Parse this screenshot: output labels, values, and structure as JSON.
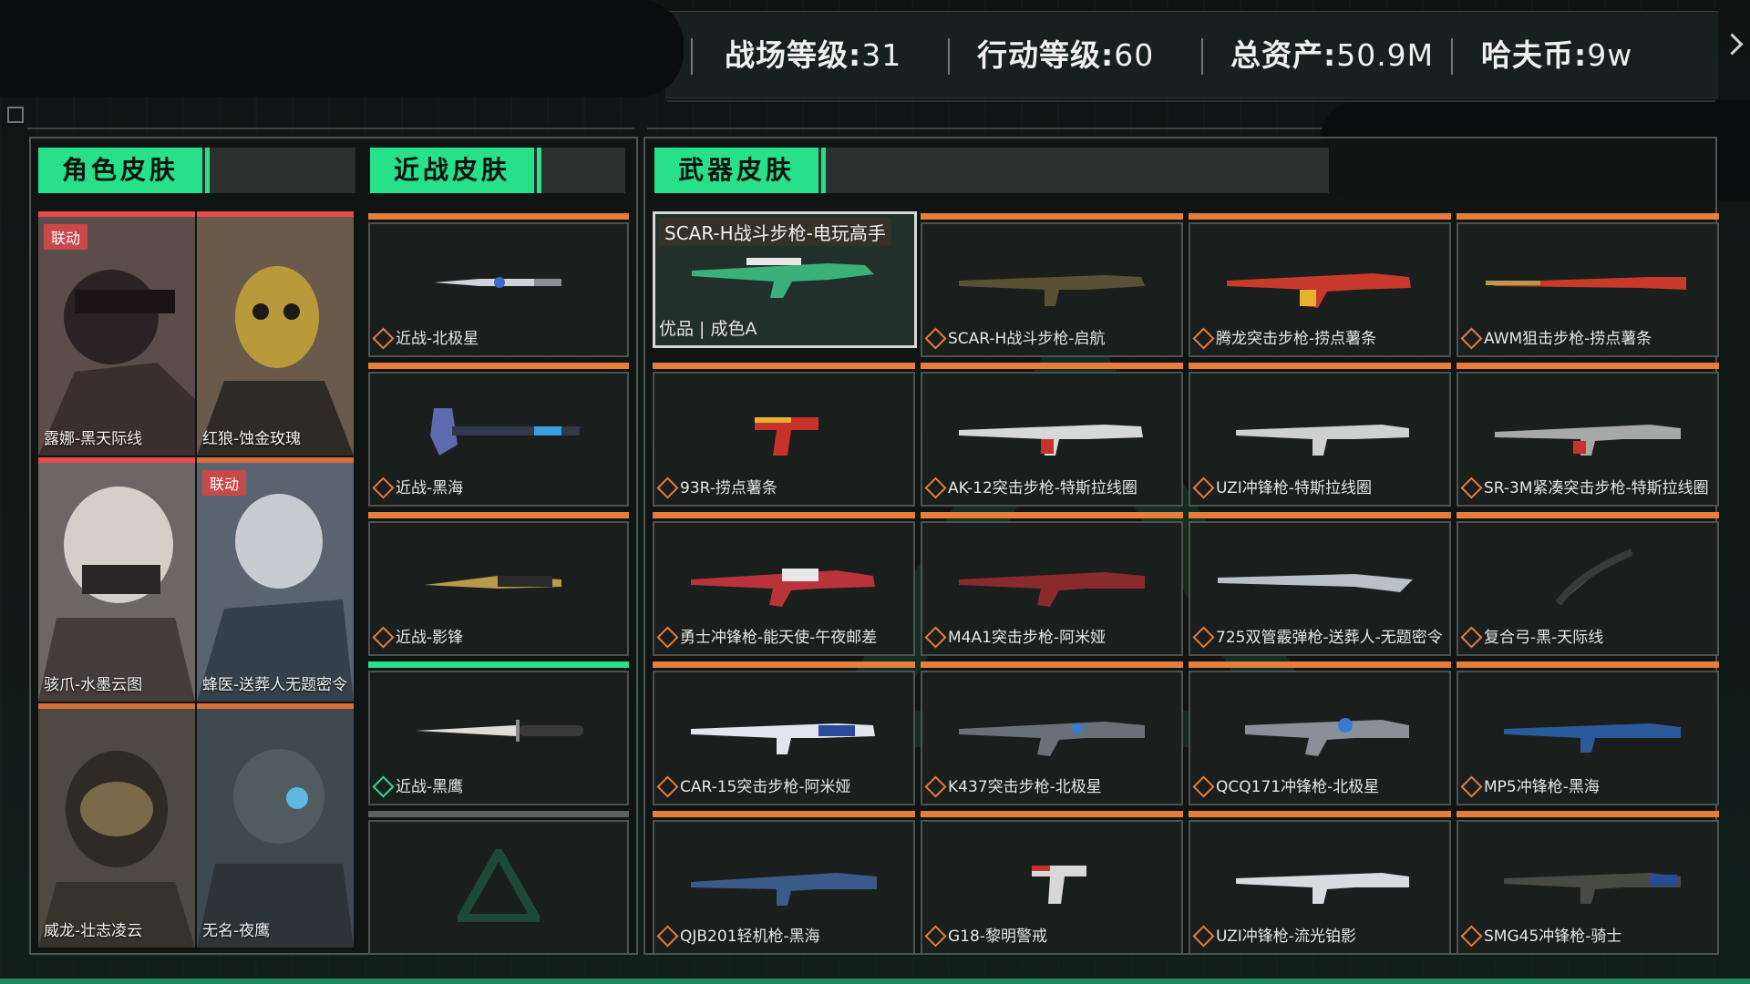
{
  "header": {
    "battle_level_label": "战场等级:",
    "battle_level_value": "31",
    "op_level_label": "行动等级:",
    "op_level_value": "60",
    "assets_label": "总资产:",
    "assets_value": "50.9M",
    "coin_label": "哈夫币:",
    "coin_value": "9w"
  },
  "tabs": {
    "character": "角色皮肤",
    "melee": "近战皮肤",
    "weapon": "武器皮肤"
  },
  "characters": [
    {
      "name": "露娜-黑天际线",
      "badge": "联动"
    },
    {
      "name": "红狼-蚀金玫瑰",
      "badge": ""
    },
    {
      "name": "骇爪-水墨云图",
      "badge": ""
    },
    {
      "name": "蜂医-送葬人无题密令",
      "badge": "联动"
    },
    {
      "name": "威龙-壮志凌云",
      "badge": ""
    },
    {
      "name": "无名-夜鹰",
      "badge": ""
    }
  ],
  "melee": [
    {
      "name": "近战-北极星"
    },
    {
      "name": "近战-黑海"
    },
    {
      "name": "近战-影锋"
    },
    {
      "name": "近战-黑鹰"
    }
  ],
  "selected_weapon": {
    "title": "SCAR-H战斗步枪-电玩高手",
    "quality": "优品 | 成色A"
  },
  "weapons": [
    {
      "name": "SCAR-H战斗步枪-启航"
    },
    {
      "name": "腾龙突击步枪-捞点薯条"
    },
    {
      "name": "AWM狙击步枪-捞点薯条"
    },
    {
      "name": "93R-捞点薯条"
    },
    {
      "name": "AK-12突击步枪-特斯拉线圈"
    },
    {
      "name": "UZI冲锋枪-特斯拉线圈"
    },
    {
      "name": "SR-3M紧凑突击步枪-特斯拉线圈"
    },
    {
      "name": "勇士冲锋枪-能天使-午夜邮差"
    },
    {
      "name": "M4A1突击步枪-阿米娅"
    },
    {
      "name": "725双管霰弹枪-送葬人-无题密令"
    },
    {
      "name": "复合弓-黑-天际线"
    },
    {
      "name": "CAR-15突击步枪-阿米娅"
    },
    {
      "name": "K437突击步枪-北极星"
    },
    {
      "name": "QCQ171冲锋枪-北极星"
    },
    {
      "name": "MP5冲锋枪-黑海"
    },
    {
      "name": "QJB201轻机枪-黑海"
    },
    {
      "name": "G18-黎明警戒"
    },
    {
      "name": "UZI冲锋枪-流光铂影"
    },
    {
      "name": "SMG45冲锋枪-骑士"
    }
  ],
  "colors": {
    "accent_green": "#27e08a",
    "rarity_orange": "#e77d3a",
    "rarity_red": "#e84b4b"
  }
}
